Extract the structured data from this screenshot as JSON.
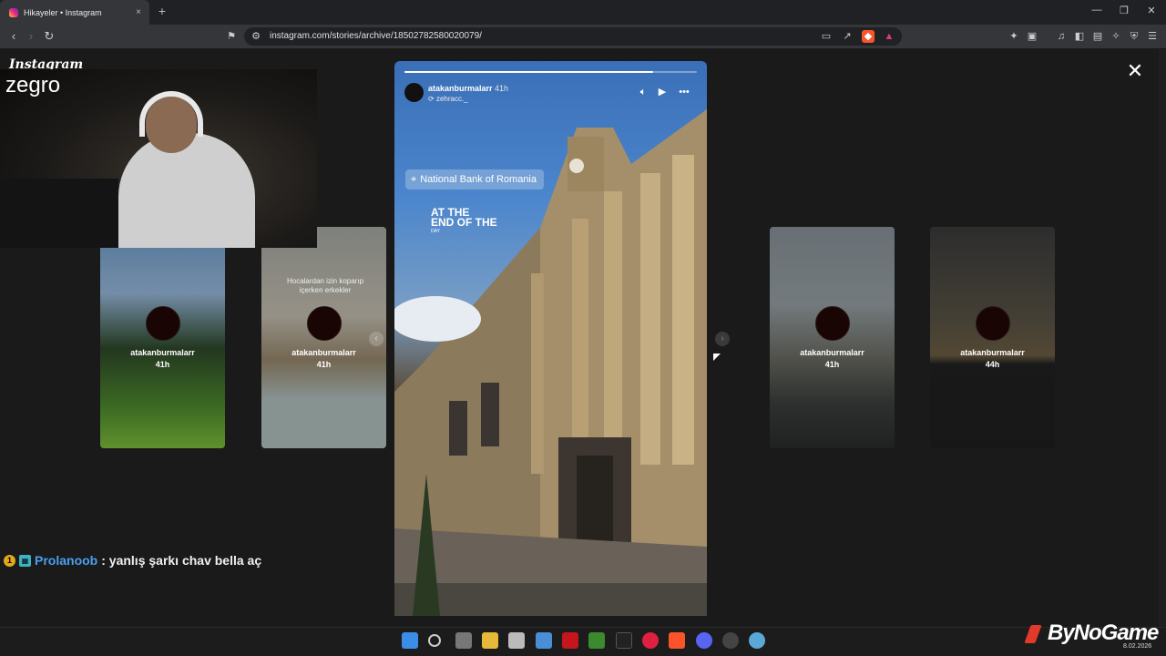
{
  "browser": {
    "tab_title": "Hikayeler • Instagram",
    "tab_close": "×",
    "new_tab": "+",
    "url": "instagram.com/stories/archive/18502782580020079/",
    "controls": {
      "minimize": "—",
      "restore": "❐",
      "close": "✕"
    }
  },
  "page": {
    "logo": "Instagram",
    "streamer_overlay": "zegro",
    "close_symbol": "✕"
  },
  "story": {
    "username": "atakanburmalarr",
    "time": "41h",
    "reposted_from": "zehracc._",
    "progress": 0.85,
    "location": "National Bank of Romania",
    "overlay_text_line1": "AT THE",
    "overlay_text_line2": "END OF THE",
    "overlay_text_line3": "DAY"
  },
  "side_stories": [
    {
      "username": "atakanburmalarr",
      "time": "41h"
    },
    {
      "username": "atakanburmalarr",
      "time": "41h",
      "caption": "Hocalardan izin koparıp içerken erkekler"
    },
    {
      "username": "atakanburmalarr",
      "time": "41h"
    },
    {
      "username": "atakanburmalarr",
      "time": "44h"
    }
  ],
  "chat": {
    "badge1": "1",
    "user": "Prolanoob",
    "message": ": yanlış şarkı chav bella aç"
  },
  "watermark": {
    "brand": "ByNoGame",
    "date": "8.02.2026"
  },
  "colors": {
    "accent": "#4a9ff0",
    "brand_red": "#e23a2a"
  }
}
